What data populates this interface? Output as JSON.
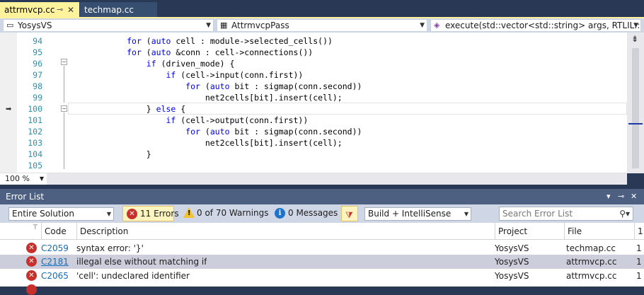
{
  "tabs": {
    "active": {
      "label": "attrmvcp.cc",
      "pin_icon": "pin-icon",
      "close_icon": "close-icon"
    },
    "inactive": {
      "label": "techmap.cc"
    }
  },
  "navbar": {
    "project": "YosysVS",
    "class": "AttrmvcpPass",
    "member": "execute(std::vector<std::string> args, RTLIL::Desig"
  },
  "editor": {
    "lines": [
      {
        "num": "94",
        "indent": "            ",
        "tokens": [
          {
            "t": "for",
            "k": true
          },
          {
            "t": " (",
            "k": false
          },
          {
            "t": "auto",
            "k": true
          },
          {
            "t": " cell : module->selected_cells())",
            "k": false
          }
        ]
      },
      {
        "num": "95",
        "indent": "            ",
        "tokens": [
          {
            "t": "for",
            "k": true
          },
          {
            "t": " (",
            "k": false
          },
          {
            "t": "auto",
            "k": true
          },
          {
            "t": " &conn : cell->connections())",
            "k": false
          }
        ]
      },
      {
        "num": "96",
        "indent": "                ",
        "tokens": [
          {
            "t": "if",
            "k": true
          },
          {
            "t": " (driven_mode) {",
            "k": false
          }
        ]
      },
      {
        "num": "97",
        "indent": "                    ",
        "tokens": [
          {
            "t": "if",
            "k": true
          },
          {
            "t": " (cell->input(conn.first))",
            "k": false
          }
        ]
      },
      {
        "num": "98",
        "indent": "                        ",
        "tokens": [
          {
            "t": "for",
            "k": true
          },
          {
            "t": " (",
            "k": false
          },
          {
            "t": "auto",
            "k": true
          },
          {
            "t": " bit : sigmap(conn.second))",
            "k": false
          }
        ]
      },
      {
        "num": "99",
        "indent": "                            ",
        "tokens": [
          {
            "t": "net2cells[bit].insert(cell);",
            "k": false
          }
        ]
      },
      {
        "num": "100",
        "indent": "                ",
        "tokens": [
          {
            "t": "} ",
            "k": false
          },
          {
            "t": "else",
            "k": true
          },
          {
            "t": " {",
            "k": false
          }
        ]
      },
      {
        "num": "101",
        "indent": "                    ",
        "tokens": [
          {
            "t": "if",
            "k": true
          },
          {
            "t": " (cell->output(conn.first))",
            "k": false
          }
        ]
      },
      {
        "num": "102",
        "indent": "                        ",
        "tokens": [
          {
            "t": "for",
            "k": true
          },
          {
            "t": " (",
            "k": false
          },
          {
            "t": "auto",
            "k": true
          },
          {
            "t": " bit : sigmap(conn.second))",
            "k": false
          }
        ]
      },
      {
        "num": "103",
        "indent": "                            ",
        "tokens": [
          {
            "t": "net2cells[bit].insert(cell);",
            "k": false
          }
        ]
      },
      {
        "num": "104",
        "indent": "                ",
        "tokens": [
          {
            "t": "}",
            "k": false
          }
        ]
      },
      {
        "num": "105",
        "indent": "",
        "tokens": []
      }
    ],
    "zoom": "100 %"
  },
  "error_list": {
    "title": "Error List",
    "scope": "Entire Solution",
    "errors_btn": "11 Errors",
    "warnings_btn": "0 of 70 Warnings",
    "messages_btn": "0 Messages",
    "build_filter": "Build + IntelliSense",
    "search_placeholder": "Search Error List",
    "columns": {
      "code": "Code",
      "description": "Description",
      "project": "Project",
      "file": "File",
      "line": "1"
    },
    "rows": [
      {
        "code": "C2059",
        "description": "syntax error: '}'",
        "project": "YosysVS",
        "file": "techmap.cc",
        "line": "1"
      },
      {
        "code": "C2181",
        "description": "illegal else without matching if",
        "project": "YosysVS",
        "file": "attrmvcp.cc",
        "line": "1"
      },
      {
        "code": "C2065",
        "description": "'cell': undeclared identifier",
        "project": "YosysVS",
        "file": "attrmvcp.cc",
        "line": "1"
      }
    ]
  },
  "colors": {
    "tab_active": "#fff29d",
    "error_red": "#c9302c",
    "link_blue": "#0e70c0",
    "keyword_blue": "#0000ff",
    "line_number": "#2b91af"
  }
}
